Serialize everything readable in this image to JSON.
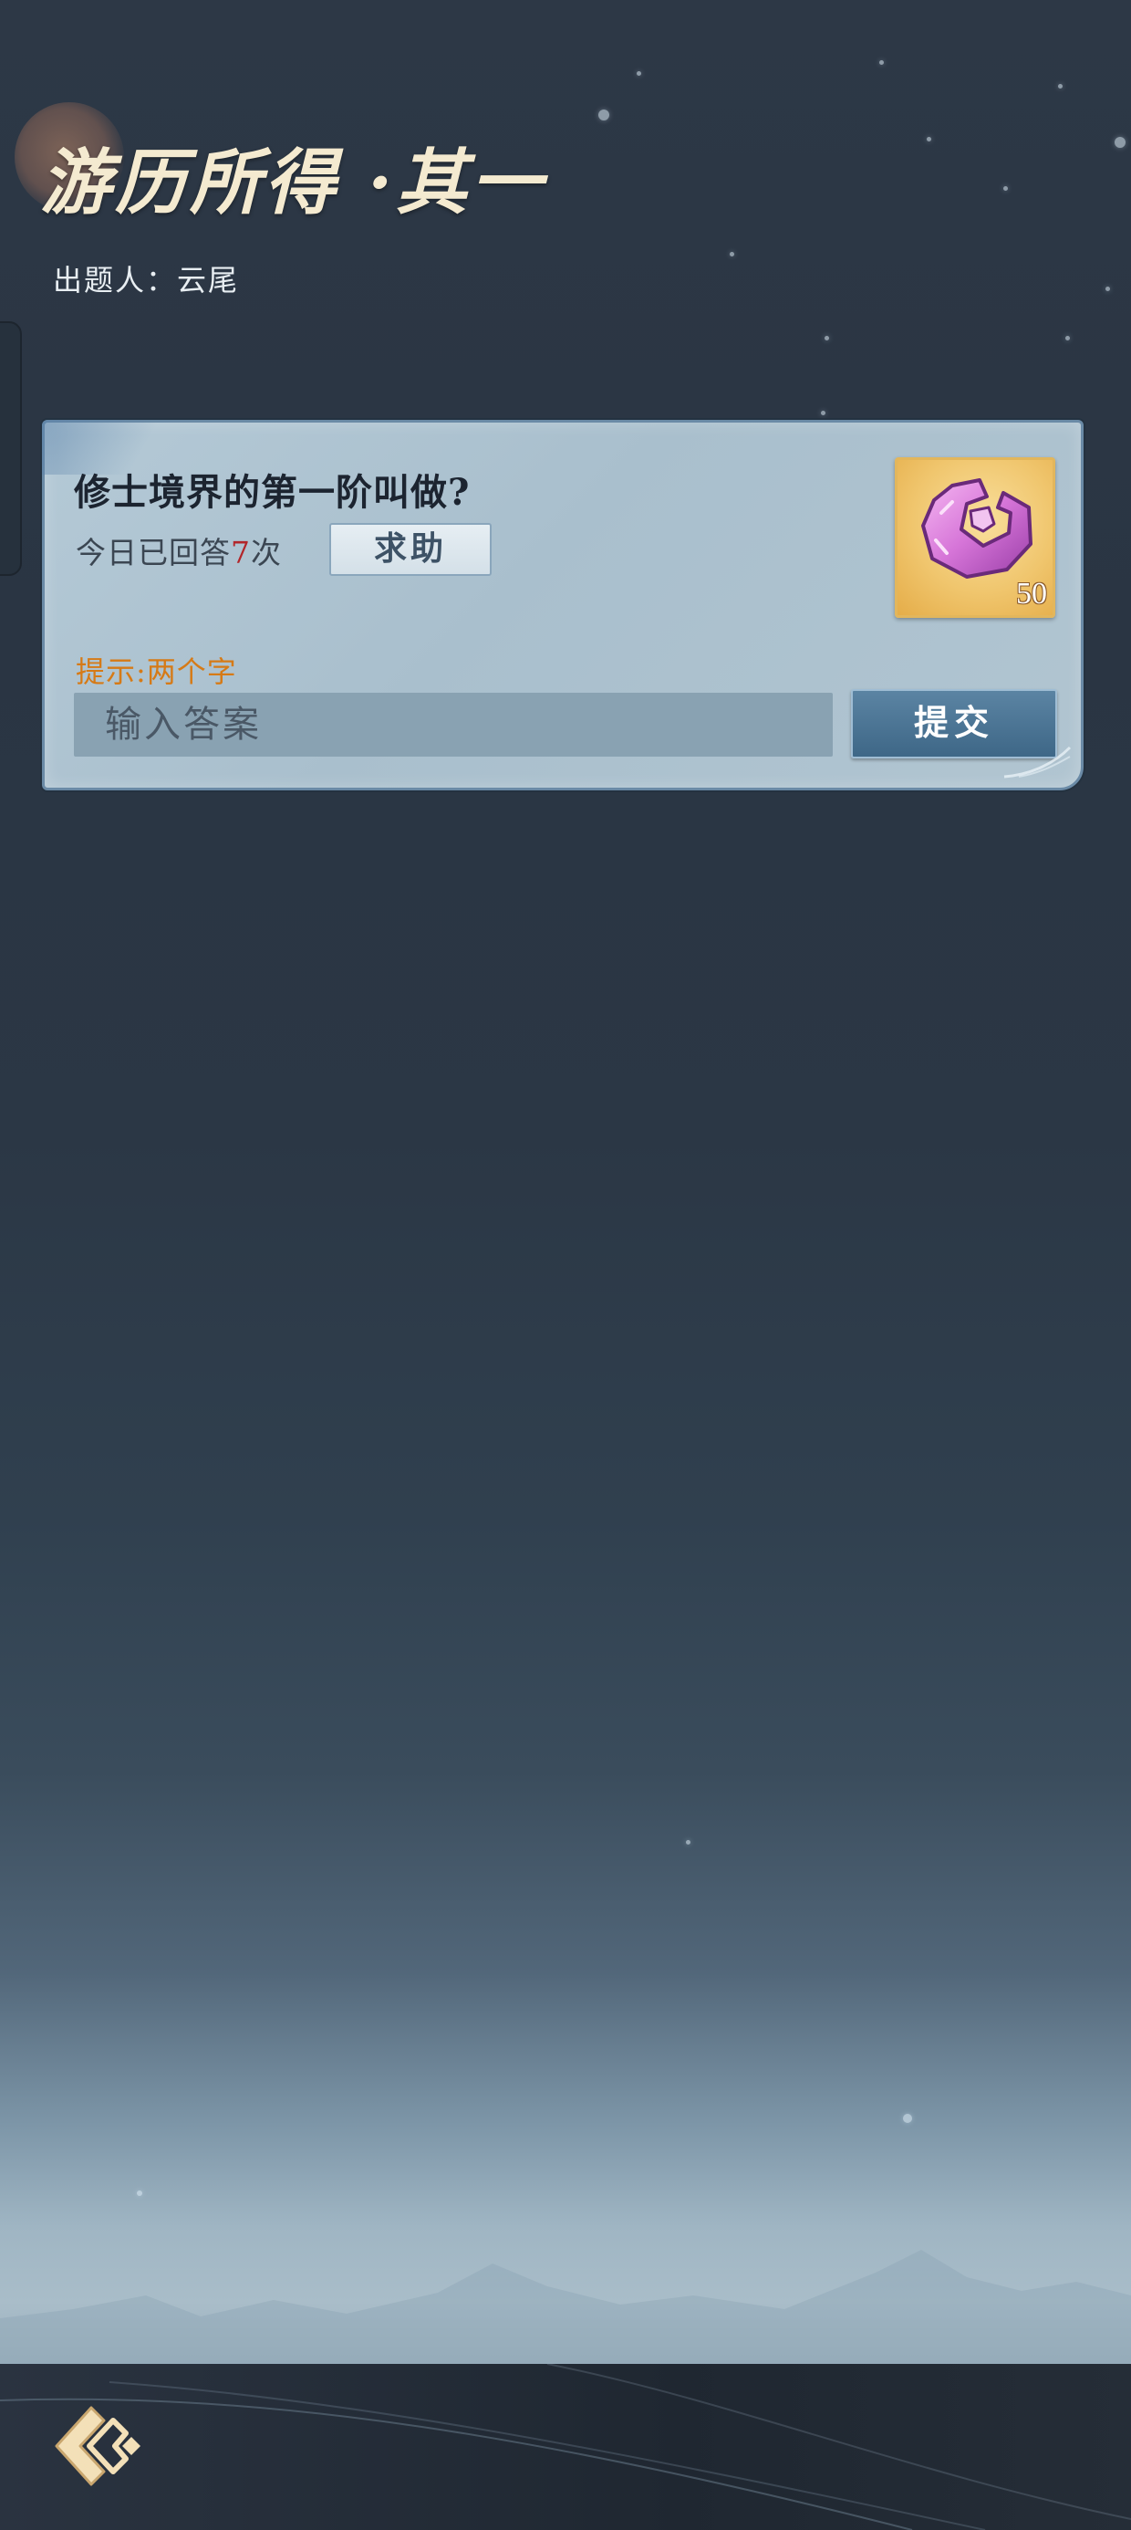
{
  "page": {
    "title": "游历所得 ·其一",
    "author_label": "出题人：",
    "author_name": "云尾"
  },
  "quiz": {
    "question": "修士境界的第一阶叫做?",
    "answered_prefix": "今日已回答",
    "answered_count": "7",
    "answered_suffix": "次",
    "help_label": "求助",
    "hint": "提示:两个字",
    "answer_placeholder": "输入答案",
    "answer_value": "",
    "submit_label": "提交",
    "reward": {
      "icon": "purple-gem-icon",
      "quantity": "50"
    }
  },
  "footer": {
    "back_icon": "back-arrow-icon"
  },
  "colors": {
    "title": "#f4ead0",
    "hint": "#d67a16",
    "answered_count": "#b2262a",
    "submit_bg": "#4a7393",
    "card_bg": "#aec3d0"
  }
}
